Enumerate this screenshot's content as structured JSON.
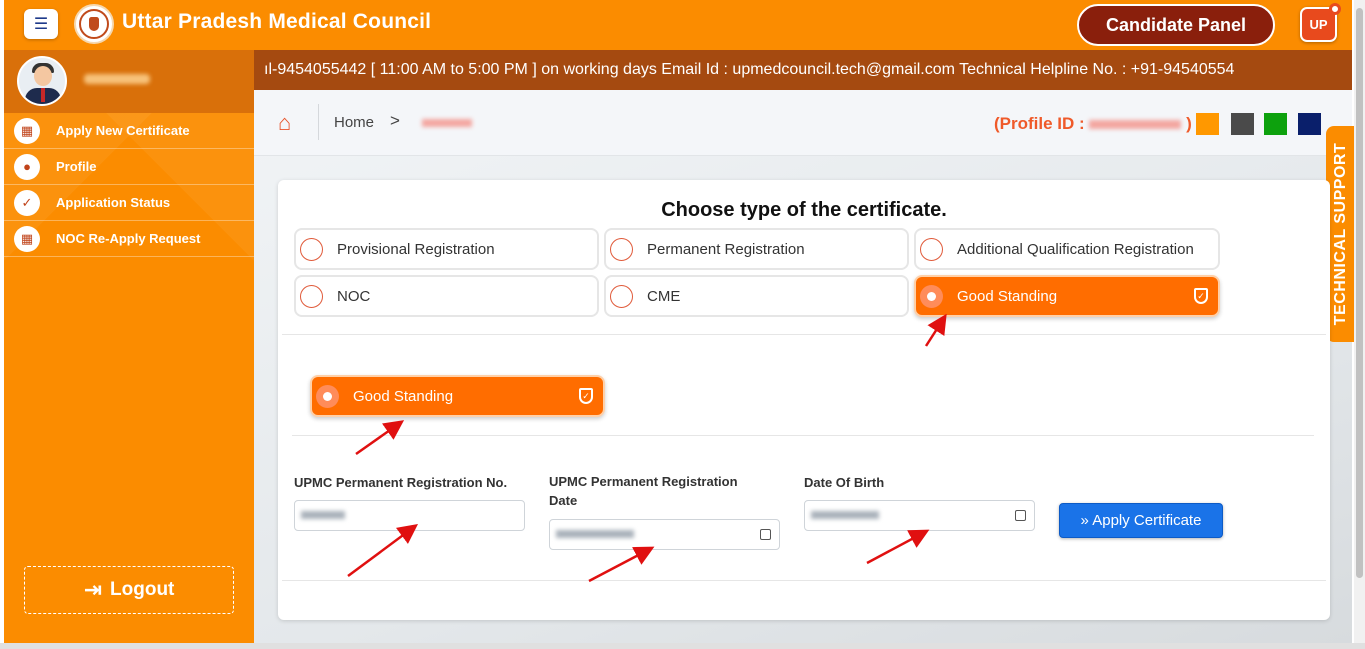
{
  "header": {
    "title": "Uttar Pradesh Medical Council",
    "candidate_panel": "Candidate Panel",
    "user_badge": "UP"
  },
  "sidebar": {
    "items": [
      {
        "label": "Apply New Certificate",
        "icon": "grid-icon"
      },
      {
        "label": "Profile",
        "icon": "user-icon"
      },
      {
        "label": "Application Status",
        "icon": "check-circle-icon"
      },
      {
        "label": "NOC Re-Apply Request",
        "icon": "grid-icon"
      }
    ],
    "logout": "Logout"
  },
  "ticker": {
    "text": "ıl-9454055442 [ 11:00 AM to 5:00 PM ] on working days   Email Id : upmedcouncil.tech@gmail.com   Technical Helpline No. : +91-94540554"
  },
  "breadcrumb": {
    "home": "Home",
    "separator": ">"
  },
  "profile_id": {
    "prefix": "(Profile ID :",
    "suffix": ")"
  },
  "theme_swatches": [
    "#ff9800",
    "#4a4a4a",
    "#0da10d",
    "#0a1f6b"
  ],
  "tech_support": "TECHNICAL SUPPORT",
  "card": {
    "title": "Choose type of the certificate.",
    "options": [
      {
        "label": "Provisional Registration",
        "selected": false
      },
      {
        "label": "Permanent Registration",
        "selected": false
      },
      {
        "label": "Additional Qualification Registration",
        "selected": false
      },
      {
        "label": "NOC",
        "selected": false
      },
      {
        "label": "CME",
        "selected": false
      },
      {
        "label": "Good Standing",
        "selected": true
      }
    ],
    "selected_summary": "Good Standing",
    "fields": {
      "reg_no_label": "UPMC Permanent Registration No.",
      "reg_date_label": "UPMC Permanent Registration Date",
      "dob_label": "Date Of Birth"
    },
    "apply_button": "» Apply Certificate"
  },
  "colors": {
    "primary_orange": "#fb8c00",
    "ticker_brown": "#a54a10",
    "selected_orange": "#ff6d00",
    "apply_blue": "#1a73e8",
    "annotation_red": "#e01010"
  }
}
